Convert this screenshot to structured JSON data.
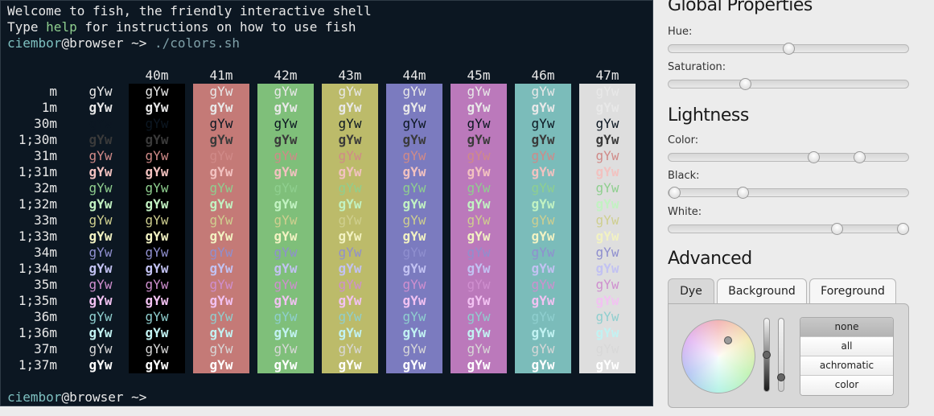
{
  "terminal": {
    "welcome": "Welcome to fish, the friendly interactive shell",
    "type_prefix": "Type ",
    "help_word": "help",
    "type_suffix": " for instructions on how to use fish",
    "user": "ciembor",
    "at_host": "@browser",
    "prompt_symbol": " ~> ",
    "command": "./colors.sh",
    "sample": "gYw",
    "background_headers": [
      "40m",
      "41m",
      "42m",
      "43m",
      "44m",
      "45m",
      "46m",
      "47m"
    ],
    "row_labels": [
      "m",
      "1m",
      "30m",
      "1;30m",
      "31m",
      "1;31m",
      "32m",
      "1;32m",
      "33m",
      "1;33m",
      "34m",
      "1;34m",
      "35m",
      "1;35m",
      "36m",
      "1;36m",
      "37m",
      "1;37m"
    ]
  },
  "colors": {
    "bg_default": "#0c1722",
    "bg40": "#000000",
    "bg41": "#c47a77",
    "bg42": "#7fbf7a",
    "bg43": "#bcbb6a",
    "bg44": "#7b7bbf",
    "bg45": "#bb79bb",
    "bg46": "#7bbcba",
    "bg47": "#dedede",
    "fg_default": "#e8e8e8",
    "fg30": "#0c1722",
    "fg1_30": "#3a3a3a",
    "fg31": "#d08a88",
    "fg1_31": "#f2c2c0",
    "fg32": "#8fcf8f",
    "fg1_32": "#c2f2c2",
    "fg33": "#cfcf8f",
    "fg1_33": "#f2f2c2",
    "fg34": "#8f8fcf",
    "fg1_34": "#c2c2f2",
    "fg35": "#cf8fcf",
    "fg1_35": "#f2c2f2",
    "fg36": "#8fcfcf",
    "fg1_36": "#c2f2f2",
    "fg37": "#d8d8d8",
    "fg1_37": "#ffffff"
  },
  "panel": {
    "global_title": "Global Properties",
    "hue_label": "Hue:",
    "hue_value": 0.5,
    "saturation_label": "Saturation:",
    "saturation_value": 0.31,
    "lightness_title": "Lightness",
    "color_label": "Color:",
    "color_values": [
      0.61,
      0.81
    ],
    "black_label": "Black:",
    "black_values": [
      0.0,
      0.3
    ],
    "white_label": "White:",
    "white_values": [
      0.71,
      1.0
    ],
    "advanced_title": "Advanced",
    "tabs": [
      "Dye",
      "Background",
      "Foreground"
    ],
    "active_tab": "Dye",
    "dye_options": [
      "none",
      "all",
      "achromatic",
      "color"
    ],
    "selected_option": "none"
  }
}
